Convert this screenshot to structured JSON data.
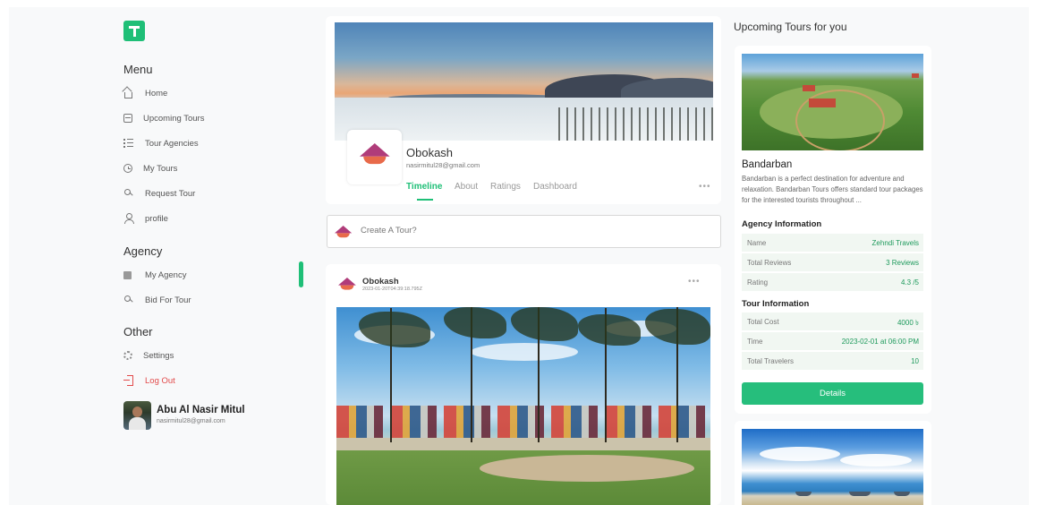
{
  "sidebar": {
    "menu_title": "Menu",
    "menu_items": [
      {
        "label": "Home",
        "icon": "home-icon"
      },
      {
        "label": "Upcoming Tours",
        "icon": "calendar-icon"
      },
      {
        "label": "Tour Agencies",
        "icon": "list-icon"
      },
      {
        "label": "My Tours",
        "icon": "clock-icon"
      },
      {
        "label": "Request Tour",
        "icon": "request-icon"
      },
      {
        "label": "profile",
        "icon": "user-icon"
      }
    ],
    "agency_title": "Agency",
    "agency_items": [
      {
        "label": "My Agency",
        "icon": "agency-icon"
      },
      {
        "label": "Bid For Tour",
        "icon": "bid-icon"
      }
    ],
    "other_title": "Other",
    "other_items": [
      {
        "label": "Settings",
        "icon": "gear-icon"
      },
      {
        "label": "Log Out",
        "icon": "logout-icon"
      }
    ],
    "user": {
      "name": "Abu Al Nasir Mitul",
      "email": "nasirmitul28@gmail.com"
    }
  },
  "profile": {
    "name": "Obokash",
    "email": "nasirmitul28@gmail.com",
    "tabs": [
      "Timeline",
      "About",
      "Ratings",
      "Dashboard"
    ],
    "active_tab": "Timeline",
    "more": "•••"
  },
  "create_tour": {
    "placeholder": "Create A Tour?"
  },
  "post": {
    "author": "Obokash",
    "timestamp": "2023-01-20T04:39:18.795Z",
    "more": "•••"
  },
  "right": {
    "title": "Upcoming Tours for you",
    "tour": {
      "name": "Bandarban",
      "description": "Bandarban is a perfect destination for adventure and relaxation. Bandarban Tours offers standard tour packages for the interested tourists throughout ...",
      "agency_heading": "Agency Information",
      "agency_rows": [
        {
          "k": "Name",
          "v": "Zehndi Travels"
        },
        {
          "k": "Total Reviews",
          "v": "3 Reviews"
        },
        {
          "k": "Rating",
          "v": "4.3 /5"
        }
      ],
      "tour_heading": "Tour Information",
      "tour_rows": [
        {
          "k": "Total Cost",
          "v": "4000 ৳"
        },
        {
          "k": "Time",
          "v": "2023-02-01 at 06:00 PM"
        },
        {
          "k": "Total Travelers",
          "v": "10"
        }
      ],
      "details_label": "Details"
    }
  },
  "colors": {
    "accent": "#1fbf77",
    "logout": "#e24b4b",
    "button": "#26be7c"
  }
}
